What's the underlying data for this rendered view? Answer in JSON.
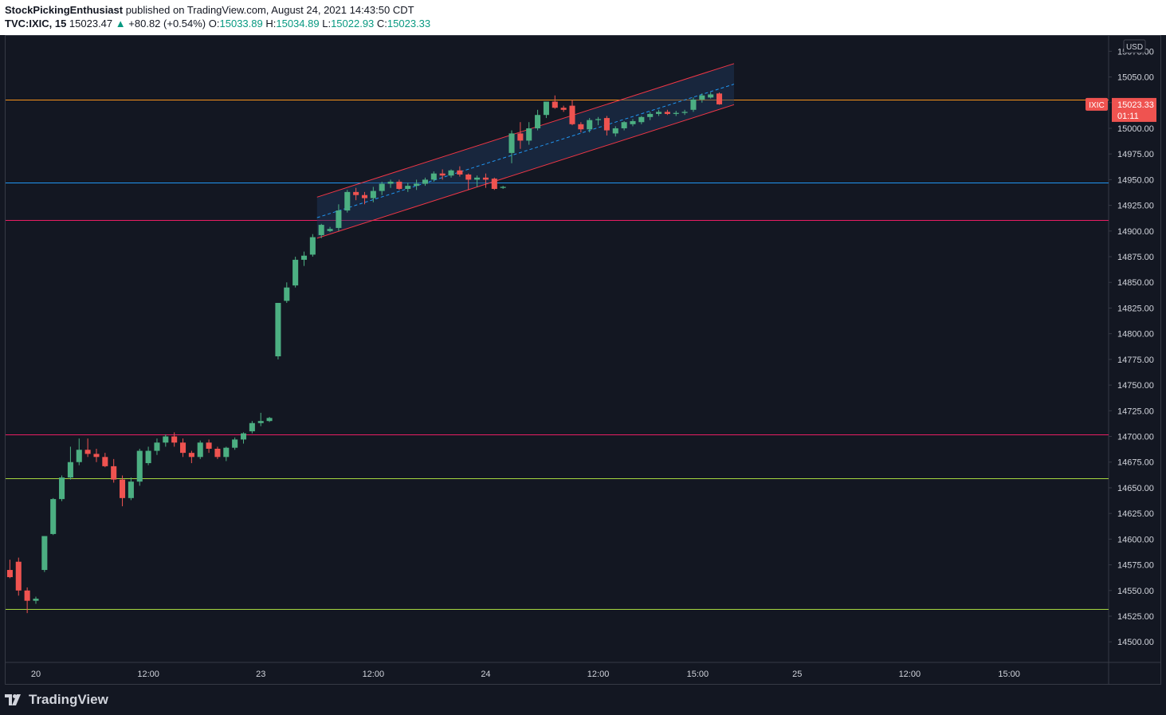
{
  "header": {
    "author": "StockPickingEnthusiast",
    "published_text": " published on TradingView.com, August 24, 2021 14:43:50 CDT",
    "symbol": "TVC:IXIC, 15",
    "last": "15023.47",
    "change_arrow": "▲",
    "change": "+80.82 (+0.54%)",
    "o_label": "O:",
    "o_value": "15033.89",
    "h_label": "H:",
    "h_value": "15034.89",
    "l_label": "L:",
    "l_value": "15022.93",
    "c_label": "C:",
    "c_value": "15023.33"
  },
  "footer": {
    "brand": "TradingView",
    "logo_icon": "tradingview-logo-icon"
  },
  "colors": {
    "background": "#131722",
    "up": "#26a69a",
    "down": "#ef5350",
    "up_candle": "#4caf82",
    "grid_border": "#363a45",
    "axis_text": "#d1d4dc",
    "orange_line": "#f7931a",
    "blue_line": "#2196f3",
    "pink_line": "#e91e63",
    "green_line": "#a5d63f",
    "channel": "#f23645",
    "channel_fill": "#1e3a5f",
    "channel_mid": "#2196f3"
  },
  "chart_data": {
    "type": "candlestick",
    "currency": "USD",
    "ylim": [
      14480,
      15090
    ],
    "y_ticks": [
      14500,
      14525,
      14550,
      14575,
      14600,
      14625,
      14650,
      14675,
      14700,
      14725,
      14750,
      14775,
      14800,
      14825,
      14850,
      14875,
      14900,
      14925,
      14950,
      14975,
      15000,
      15025,
      15050,
      15075
    ],
    "x_tick_labels": [
      {
        "bar": 3,
        "label": "20"
      },
      {
        "bar": 16,
        "label": "12:00"
      },
      {
        "bar": 29,
        "label": "23"
      },
      {
        "bar": 42,
        "label": "12:00"
      },
      {
        "bar": 55,
        "label": "24"
      },
      {
        "bar": 68,
        "label": "12:00"
      },
      {
        "bar": 79.5,
        "label": "15:00"
      },
      {
        "bar": 91,
        "label": "25"
      },
      {
        "bar": 104,
        "label": "12:00"
      },
      {
        "bar": 115.5,
        "label": "15:00"
      }
    ],
    "x_range": [
      -0.5,
      127
    ],
    "candles": [
      [
        14570,
        14580,
        14562,
        14563
      ],
      [
        14578,
        14582,
        14545,
        14550
      ],
      [
        14550,
        14553,
        14528,
        14540
      ],
      [
        14540,
        14544,
        14537,
        14542
      ],
      [
        14570,
        14603,
        14568,
        14603
      ],
      [
        14605,
        14640,
        14604,
        14639
      ],
      [
        14639,
        14662,
        14637,
        14660
      ],
      [
        14660,
        14690,
        14658,
        14675
      ],
      [
        14675,
        14698,
        14672,
        14687
      ],
      [
        14687,
        14698,
        14680,
        14683
      ],
      [
        14683,
        14688,
        14675,
        14680
      ],
      [
        14680,
        14684,
        14670,
        14671
      ],
      [
        14671,
        14678,
        14655,
        14658
      ],
      [
        14658,
        14662,
        14632,
        14640
      ],
      [
        14640,
        14660,
        14638,
        14656
      ],
      [
        14656,
        14688,
        14652,
        14686
      ],
      [
        14674,
        14690,
        14672,
        14686
      ],
      [
        14686,
        14698,
        14682,
        14694
      ],
      [
        14694,
        14702,
        14690,
        14700
      ],
      [
        14700,
        14704,
        14690,
        14694
      ],
      [
        14694,
        14698,
        14680,
        14684
      ],
      [
        14684,
        14686,
        14674,
        14680
      ],
      [
        14680,
        14696,
        14678,
        14694
      ],
      [
        14694,
        14697,
        14684,
        14688
      ],
      [
        14688,
        14690,
        14678,
        14680
      ],
      [
        14680,
        14690,
        14676,
        14689
      ],
      [
        14689,
        14699,
        14687,
        14697
      ],
      [
        14697,
        14704,
        14693,
        14703
      ],
      [
        14705,
        14715,
        14703,
        14713
      ],
      [
        14713,
        14723,
        14710,
        14715
      ],
      [
        14715,
        14719,
        14714,
        14718
      ],
      [
        14778,
        14830,
        14775,
        14830
      ],
      [
        14832,
        14850,
        14830,
        14845
      ],
      [
        14847,
        14875,
        14845,
        14872
      ],
      [
        14872,
        14880,
        14866,
        14876
      ],
      [
        14877,
        14897,
        14875,
        14894
      ],
      [
        14896,
        14907,
        14893,
        14906
      ],
      [
        14900,
        14904,
        14899,
        14902
      ],
      [
        14903,
        14926,
        14900,
        14920
      ],
      [
        14920,
        14940,
        14918,
        14938
      ],
      [
        14938,
        14942,
        14930,
        14935
      ],
      [
        14935,
        14938,
        14926,
        14932
      ],
      [
        14932,
        14943,
        14928,
        14939
      ],
      [
        14939,
        14948,
        14935,
        14946
      ],
      [
        14946,
        14950,
        14942,
        14948
      ],
      [
        14948,
        14950,
        14940,
        14941
      ],
      [
        14941,
        14947,
        14938,
        14944
      ],
      [
        14944,
        14950,
        14940,
        14946
      ],
      [
        14946,
        14952,
        14944,
        14950
      ],
      [
        14950,
        14958,
        14948,
        14956
      ],
      [
        14956,
        14960,
        14950,
        14954
      ],
      [
        14954,
        14960,
        14952,
        14959
      ],
      [
        14959,
        14963,
        14953,
        14955
      ],
      [
        14955,
        14956,
        14940,
        14950
      ],
      [
        14950,
        14954,
        14943,
        14952
      ],
      [
        14952,
        14956,
        14942,
        14950
      ],
      [
        14951,
        14952,
        14940,
        14941
      ],
      [
        14942,
        14944,
        14941,
        14943
      ],
      [
        14976,
        14998,
        14966,
        14995
      ],
      [
        14995,
        15006,
        14980,
        14988
      ],
      [
        14988,
        15006,
        14984,
        15000
      ],
      [
        15000,
        15018,
        14998,
        15013
      ],
      [
        15013,
        15025,
        15010,
        15026
      ],
      [
        15026,
        15032,
        15019,
        15020
      ],
      [
        15020,
        15022,
        15016,
        15018
      ],
      [
        15022,
        15028,
        15003,
        15004
      ],
      [
        15004,
        15006,
        14996,
        14999
      ],
      [
        14999,
        15010,
        14996,
        15008
      ],
      [
        15008,
        15011,
        15003,
        15009
      ],
      [
        15010,
        15012,
        14993,
        14998
      ],
      [
        14995,
        15002,
        14992,
        15000
      ],
      [
        15000,
        15007,
        14998,
        15006
      ],
      [
        15004,
        15009,
        15002,
        15007
      ],
      [
        15006,
        15012,
        15004,
        15011
      ],
      [
        15011,
        15016,
        15008,
        15014
      ],
      [
        15014,
        15018,
        15012,
        15016
      ],
      [
        15016,
        15018,
        15013,
        15014
      ],
      [
        15014,
        15017,
        15012,
        15015
      ],
      [
        15015,
        15018,
        15013,
        15016
      ],
      [
        15018,
        15030,
        15016,
        15028
      ],
      [
        15028,
        15034,
        15025,
        15032
      ],
      [
        15030,
        15035,
        15029,
        15033
      ],
      [
        15033.89,
        15034.89,
        15022.93,
        15023.33
      ]
    ],
    "horizontal_lines": [
      {
        "price": 15028,
        "color": "orange"
      },
      {
        "price": 14947,
        "color": "blue"
      },
      {
        "price": 14911,
        "color": "pink"
      },
      {
        "price": 14702,
        "color": "pink"
      },
      {
        "price": 14659,
        "color": "green"
      },
      {
        "price": 14532,
        "color": "green"
      }
    ],
    "channel": {
      "start_bar": 35.5,
      "end_bar": 83.7,
      "upper": [
        14933,
        15063
      ],
      "lower": [
        14893,
        15023
      ],
      "mid": [
        14913,
        15043
      ]
    },
    "price_label": {
      "symbol": "IXIC",
      "price": "15023.33",
      "countdown": "01:11",
      "value": 15023.33
    }
  }
}
